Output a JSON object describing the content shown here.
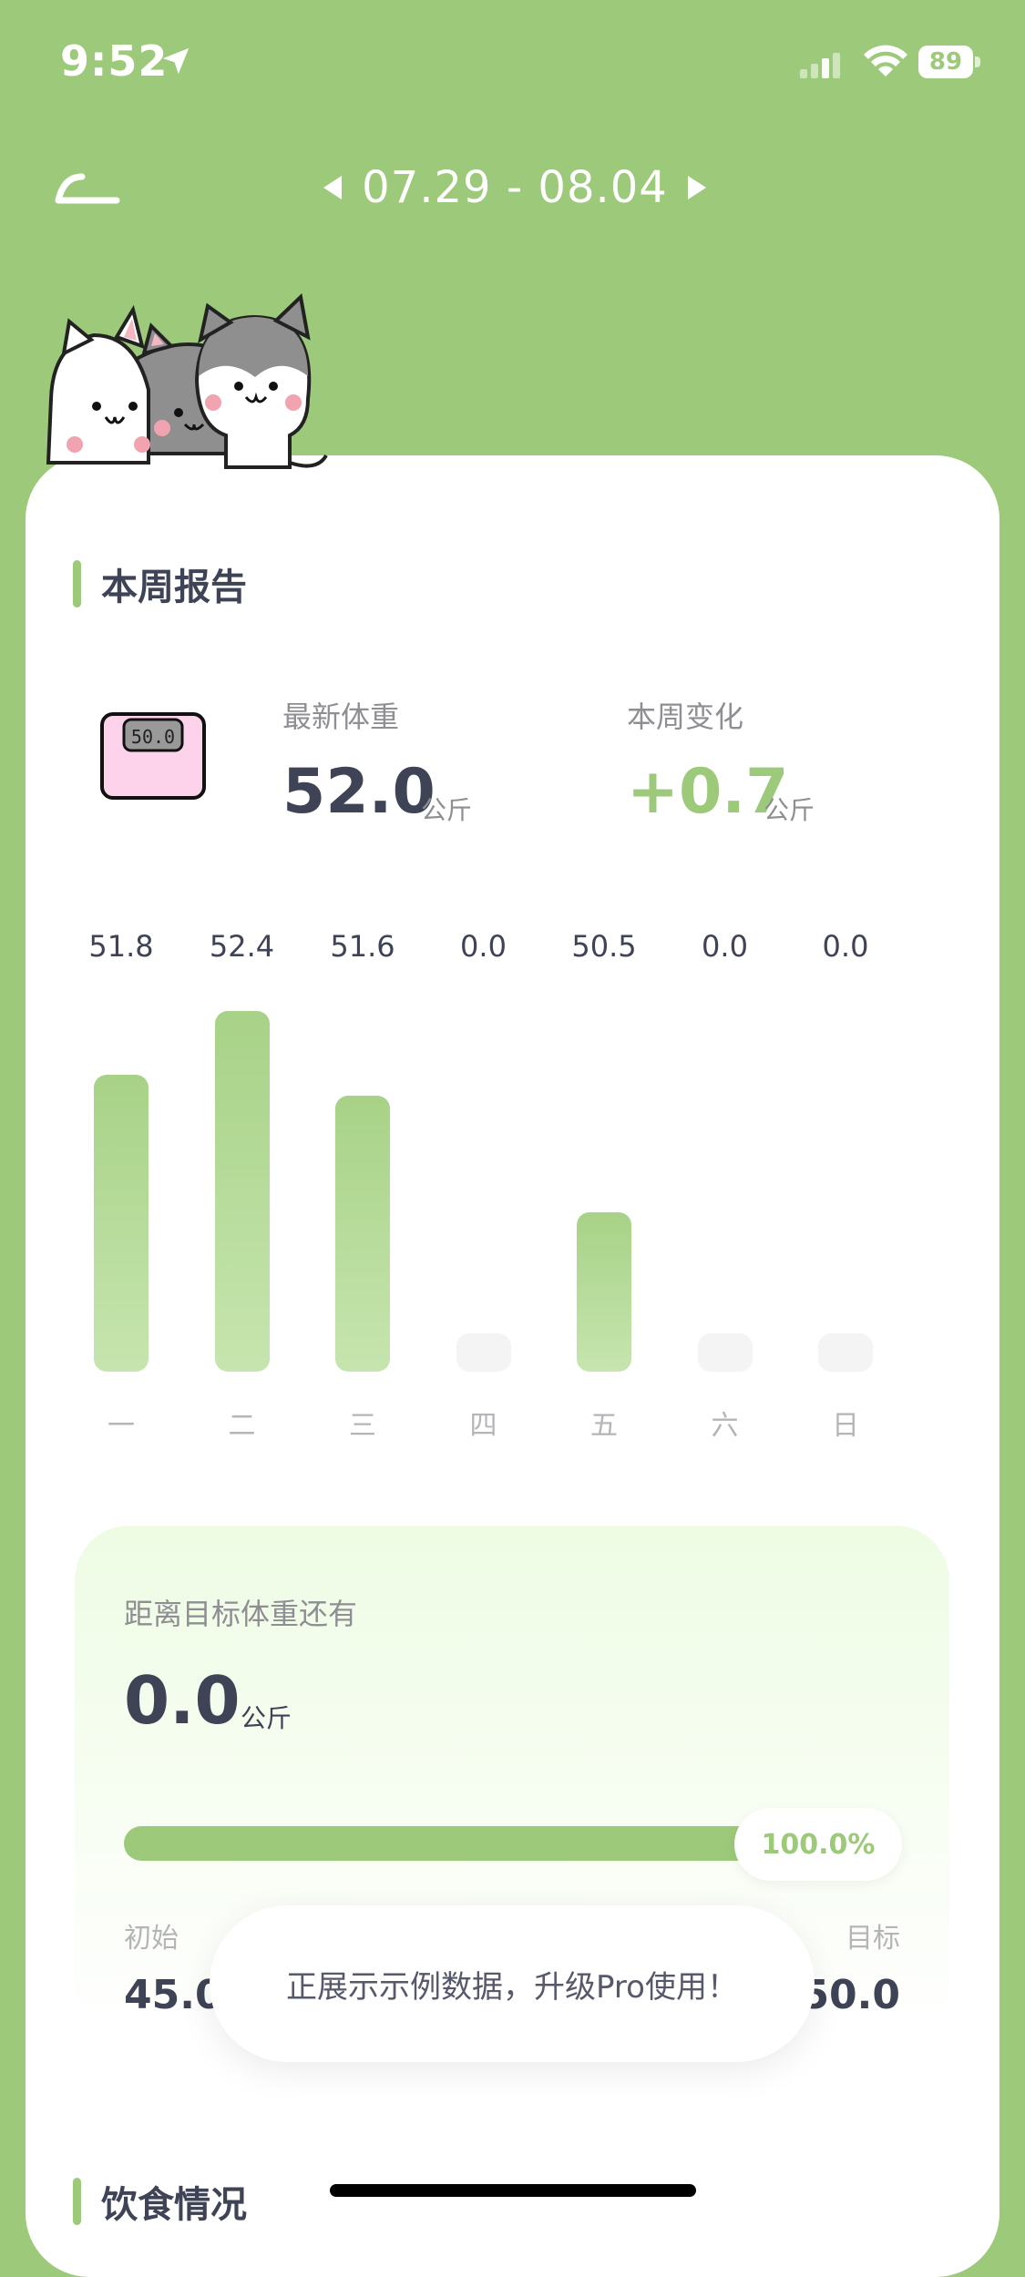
{
  "status": {
    "time": "9:52",
    "battery": "89"
  },
  "header": {
    "date_range": "07.29 - 08.04"
  },
  "report": {
    "title": "本周报告",
    "scale_display": "50.0",
    "latest_label": "最新体重",
    "latest_value": "52.0",
    "latest_unit": "公斤",
    "change_label": "本周变化",
    "change_value": "+0.7",
    "change_unit": "公斤"
  },
  "colors": {
    "accent": "#9DC97A",
    "text_dark": "#3e4355",
    "text_gray": "#8e8e93"
  },
  "chart_data": {
    "type": "bar",
    "categories": [
      "一",
      "二",
      "三",
      "四",
      "五",
      "六",
      "日"
    ],
    "values": [
      51.8,
      52.4,
      51.6,
      0.0,
      50.5,
      0.0,
      0.0
    ],
    "value_labels": [
      "51.8",
      "52.4",
      "51.6",
      "0.0",
      "50.5",
      "0.0",
      "0.0"
    ],
    "title": "",
    "xlabel": "",
    "ylabel": "",
    "grid": false
  },
  "goal": {
    "label": "距离目标体重还有",
    "remaining": "0.0",
    "unit": "公斤",
    "progress": 1.0,
    "progress_text": "100.0%",
    "start_label": "初始",
    "start_value": "45.0",
    "target_label": "目标",
    "target_value": "50.0"
  },
  "toast": {
    "text": "正展示示例数据，升级Pro使用！"
  },
  "diet": {
    "title": "饮食情况"
  },
  "icons": {
    "back": "back-arrow-icon",
    "prev": "prev-week-icon",
    "next": "next-week-icon",
    "scale": "scale-icon"
  }
}
